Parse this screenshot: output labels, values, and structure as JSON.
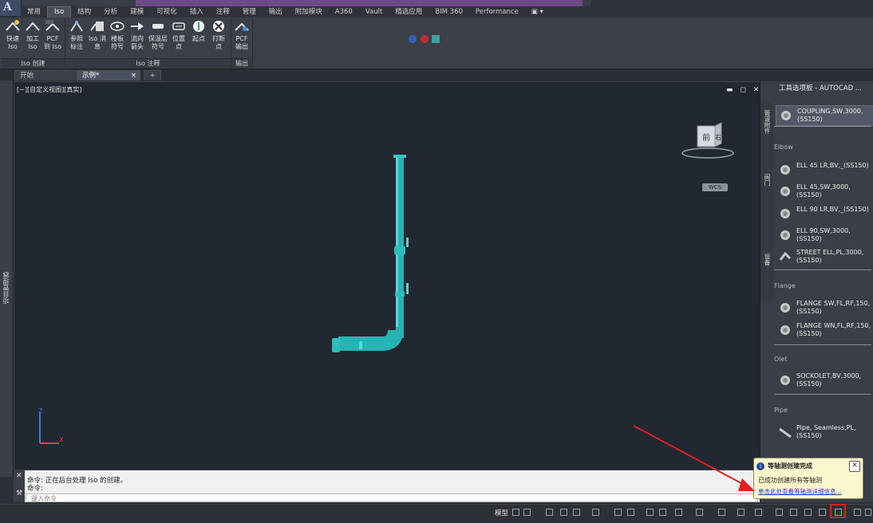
{
  "ribbon": {
    "tabs": [
      {
        "label": "常用",
        "active": false
      },
      {
        "label": "Iso",
        "active": true
      },
      {
        "label": "结构",
        "active": false
      },
      {
        "label": "分析",
        "active": false
      },
      {
        "label": "建模",
        "active": false
      },
      {
        "label": "可视化",
        "active": false
      },
      {
        "label": "插入",
        "active": false
      },
      {
        "label": "注释",
        "active": false
      },
      {
        "label": "管理",
        "active": false
      },
      {
        "label": "输出",
        "active": false
      },
      {
        "label": "附加模块",
        "active": false
      },
      {
        "label": "A360",
        "active": false
      },
      {
        "label": "Vault",
        "active": false
      },
      {
        "label": "精选应用",
        "active": false
      },
      {
        "label": "BIM 360",
        "active": false
      },
      {
        "label": "Performance",
        "active": false
      }
    ],
    "buttons": [
      {
        "label": "快速 Iso",
        "icon": "quick-iso-icon"
      },
      {
        "label": "加工 Iso",
        "icon": "production-iso-icon"
      },
      {
        "label": "PCF 到 Iso",
        "icon": "pcf-to-iso-icon"
      },
      {
        "label": "参照 标注",
        "icon": "reference-dimension-icon"
      },
      {
        "label": "Iso 消息",
        "icon": "iso-message-icon"
      },
      {
        "label": "楼板 符号",
        "icon": "floor-symbol-icon"
      },
      {
        "label": "流向 箭头",
        "icon": "flow-arrow-icon"
      },
      {
        "label": "保温层 符号",
        "icon": "insulation-symbol-icon"
      },
      {
        "label": "位置 点",
        "icon": "location-point-icon"
      },
      {
        "label": "起点",
        "icon": "start-point-icon"
      },
      {
        "label": "打断 点",
        "icon": "break-point-icon"
      },
      {
        "label": "PCF 输出",
        "icon": "pcf-export-icon"
      }
    ],
    "groups": [
      "Iso 创建",
      "Iso 注释",
      "输出"
    ]
  },
  "doc_tabs": [
    {
      "label": "开始",
      "active": false
    },
    {
      "label": "示例*",
      "active": true
    }
  ],
  "viewport": {
    "label": "[−][自定义视图][真实]",
    "viewcube_front": "前",
    "viewcube_right": "右",
    "wcs": "WCS"
  },
  "palette": {
    "title": "工具选项板 - AUTOCAD ...",
    "sections": [
      {
        "name": "",
        "items": [
          "COUPLING,SW,3000,(SS150)"
        ]
      },
      {
        "name": "Elbow",
        "items": [
          "ELL 45 LR,BV,_(SS150)",
          "ELL 45,SW,3000,(SS150)",
          "ELL 90 LR,BV,_(SS150)",
          "ELL 90,SW,3000,(SS150)",
          "STREET ELL,PL,3000,(SS150)"
        ]
      },
      {
        "name": "Flange",
        "items": [
          "FLANGE SW,FL,RF,150,(SS150)",
          "FLANGE WN,FL,RF,150,(SS150)"
        ]
      },
      {
        "name": "Olet",
        "items": [
          "SOCKOLET,BV,3000,(SS150)"
        ]
      },
      {
        "name": "Pipe",
        "items": [
          "Pipe, Seamless,PL,(SS150)"
        ]
      }
    ]
  },
  "command": {
    "line1": "命令: 正在后台处理 Iso 的创建。",
    "line2": "命令:",
    "placeholder": "键入命令"
  },
  "status": {
    "model": "模型"
  },
  "balloon": {
    "msg": "已成功创建所有等轴测"
  }
}
